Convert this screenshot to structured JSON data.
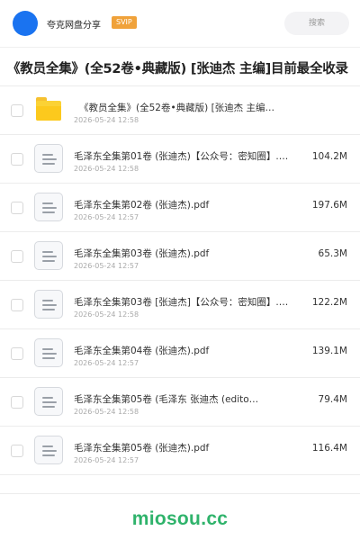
{
  "header": {
    "brand": "夸克网盘分享",
    "vip_badge": "SVIP",
    "search_placeholder": "搜索"
  },
  "page_title": "《教员全集》(全52卷•典藏版) [张迪杰 主编]目前最全收录",
  "files": [
    {
      "type": "folder",
      "name": "《教员全集》(全52卷•典藏版) [张迪杰 主编…",
      "date": "2026-05-24 12:58",
      "size": ""
    },
    {
      "type": "doc",
      "name": "毛泽东全集第01卷 (张迪杰)【公众号：密知圈】.…",
      "date": "2026-05-24 12:58",
      "size": "104.2M"
    },
    {
      "type": "doc",
      "name": "毛泽东全集第02卷 (张迪杰).pdf",
      "date": "2026-05-24 12:57",
      "size": "197.6M"
    },
    {
      "type": "doc",
      "name": "毛泽东全集第03卷 (张迪杰).pdf",
      "date": "2026-05-24 12:57",
      "size": "65.3M"
    },
    {
      "type": "doc",
      "name": "毛泽东全集第03卷 [张迪杰]【公众号：密知圈】.…",
      "date": "2026-05-24 12:58",
      "size": "122.2M"
    },
    {
      "type": "doc",
      "name": "毛泽东全集第04卷 (张迪杰).pdf",
      "date": "2026-05-24 12:57",
      "size": "139.1M"
    },
    {
      "type": "doc",
      "name": "毛泽东全集第05卷 (毛泽东 张迪杰 (edito…",
      "date": "2026-05-24 12:58",
      "size": "79.4M"
    },
    {
      "type": "doc",
      "name": "毛泽东全集第05卷 (张迪杰).pdf",
      "date": "2026-05-24 12:57",
      "size": "116.4M"
    }
  ],
  "footer": {
    "site": "miosou.cc"
  },
  "colors": {
    "accent": "#1a73f0",
    "vip": "#f0a23a",
    "folder": "#fbd235",
    "logo": "#2fb36b"
  }
}
